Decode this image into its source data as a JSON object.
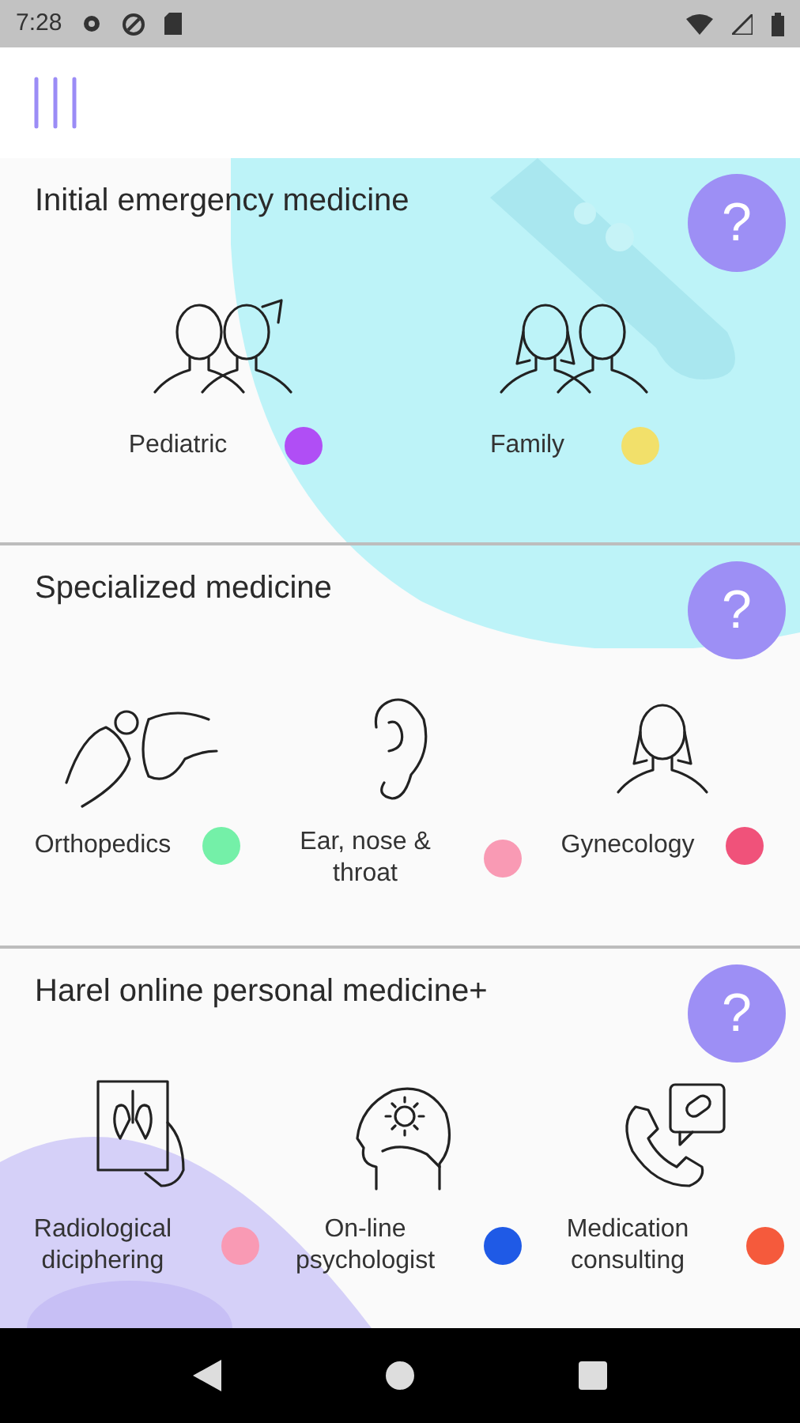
{
  "status_bar": {
    "time": "7:28"
  },
  "sections": [
    {
      "title": "Initial emergency medicine",
      "help": "?",
      "items": [
        {
          "label": "Pediatric",
          "color": "#b04ef5"
        },
        {
          "label": "Family",
          "color": "#f2e06a"
        }
      ]
    },
    {
      "title": "Specialized medicine",
      "help": "?",
      "items": [
        {
          "label": "Orthopedics",
          "color": "#74f0a8"
        },
        {
          "label": "Ear, nose & throat",
          "color": "#f99ab4"
        },
        {
          "label": "Gynecology",
          "color": "#f0527a"
        }
      ]
    },
    {
      "title": "Harel online personal medicine+",
      "help": "?",
      "items": [
        {
          "label": "Radiological diciphering",
          "color": "#f99ab4"
        },
        {
          "label": "On-line psychologist",
          "color": "#1f5ae6"
        },
        {
          "label": "Medication consulting",
          "color": "#f55a3c"
        }
      ]
    }
  ]
}
